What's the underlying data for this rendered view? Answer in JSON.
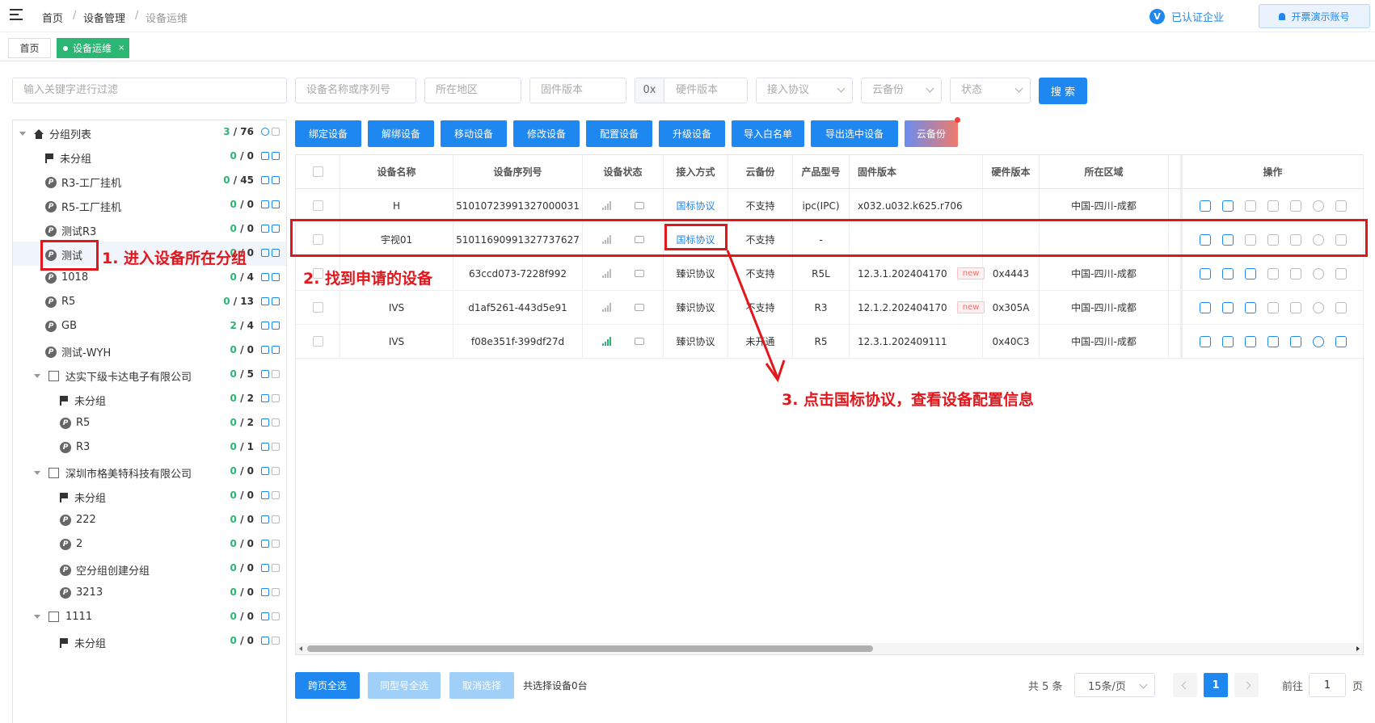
{
  "header": {
    "breadcrumb": [
      "首页",
      "/",
      "设备管理",
      "/",
      "设备运维"
    ],
    "certified_label": "已认证企业",
    "certified_badge": "V",
    "account_label": "开票演示账号"
  },
  "tabs": {
    "home": "首页",
    "active": "设备运维",
    "close": "×"
  },
  "filters": {
    "keyword_placeholder": "输入关键字进行过滤",
    "name_placeholder": "设备名称或序列号",
    "region_placeholder": "所在地区",
    "firmware_placeholder": "固件版本",
    "hex_prefix": "0x",
    "hardware_placeholder": "硬件版本",
    "protocol_placeholder": "接入协议",
    "backup_placeholder": "云备份",
    "status_placeholder": "状态",
    "search_label": "搜 索"
  },
  "tree": [
    {
      "label": "分组列表",
      "online": "3",
      "total": " / 76"
    },
    {
      "label": "未分组",
      "online": "0",
      "total": " / 0"
    },
    {
      "label": "R3-工厂挂机",
      "online": "0",
      "total": " / 45"
    },
    {
      "label": "R5-工厂挂机",
      "online": "0",
      "total": " / 0"
    },
    {
      "label": "测试R3",
      "online": "0",
      "total": " / 0"
    },
    {
      "label": "测试",
      "online": "0",
      "total": " / 0"
    },
    {
      "label": "1018",
      "online": "0",
      "total": " / 4"
    },
    {
      "label": "R5",
      "online": "0",
      "total": " / 13"
    },
    {
      "label": "GB",
      "online": "2",
      "total": " / 4"
    },
    {
      "label": "测试-WYH",
      "online": "0",
      "total": " / 0"
    },
    {
      "label": "达实下级卡达电子有限公司",
      "online": "0",
      "total": " / 5"
    },
    {
      "label": "未分组",
      "online": "0",
      "total": " / 2"
    },
    {
      "label": "R5",
      "online": "0",
      "total": " / 2"
    },
    {
      "label": "R3",
      "online": "0",
      "total": " / 1"
    },
    {
      "label": "深圳市格美特科技有限公司",
      "online": "0",
      "total": " / 0"
    },
    {
      "label": "未分组",
      "online": "0",
      "total": " / 0"
    },
    {
      "label": "222",
      "online": "0",
      "total": " / 0"
    },
    {
      "label": "2",
      "online": "0",
      "total": " / 0"
    },
    {
      "label": "空分组创建分组",
      "online": "0",
      "total": " / 0"
    },
    {
      "label": "3213",
      "online": "0",
      "total": " / 0"
    },
    {
      "label": "1111",
      "online": "0",
      "total": " / 0"
    },
    {
      "label": "未分组",
      "online": "0",
      "total": " / 0"
    }
  ],
  "actions": [
    "绑定设备",
    "解绑设备",
    "移动设备",
    "修改设备",
    "配置设备",
    "升级设备",
    "导入白名单",
    "导出选中设备",
    "云备份"
  ],
  "table": {
    "columns": [
      "设备名称",
      "设备序列号",
      "设备状态",
      "接入方式",
      "云备份",
      "产品型号",
      "固件版本",
      "硬件版本",
      "所在区域",
      "操作"
    ],
    "rows": [
      {
        "name": "H",
        "serial": "51010723991327000031",
        "online": false,
        "access": "国标协议",
        "backup": "不支持",
        "model": "ipc(IPC)",
        "firmware": "x032.u032.k625.r706",
        "is_new": false,
        "hardware": "",
        "region": "中国-四川-成都"
      },
      {
        "name": "宇视01",
        "serial": "51011690991327737627",
        "online": false,
        "access": "国标协议",
        "backup": "不支持",
        "model": "-",
        "firmware": "",
        "is_new": false,
        "hardware": "",
        "region": ""
      },
      {
        "name": "",
        "serial": "63ccd073-7228f992",
        "online": false,
        "access": "臻识协议",
        "backup": "不支持",
        "model": "R5L",
        "firmware": "12.3.1.202404170",
        "is_new": true,
        "hardware": "0x4443",
        "region": "中国-四川-成都"
      },
      {
        "name": "IVS",
        "serial": "d1af5261-443d5e91",
        "online": false,
        "access": "臻识协议",
        "backup": "不支持",
        "model": "R3",
        "firmware": "12.1.2.202404170",
        "is_new": true,
        "hardware": "0x305A",
        "region": "中国-四川-成都"
      },
      {
        "name": "IVS",
        "serial": "f08e351f-399df27d",
        "online": true,
        "access": "臻识协议",
        "backup": "未开通",
        "model": "R5",
        "firmware": "12.3.1.202409111",
        "is_new": false,
        "hardware": "0x40C3",
        "region": "中国-四川-成都"
      }
    ],
    "new_label": "new"
  },
  "footer": {
    "select_all_pages": "跨页全选",
    "select_same_model": "同型号全选",
    "cancel_selection": "取消选择",
    "selected_count": "共选择设备0台",
    "total": "共 5 条",
    "page_size": "15条/页",
    "current_page": "1",
    "goto_label": "前往",
    "goto_value": "1",
    "page_unit": "页"
  },
  "annotations": {
    "step1": "1. 进入设备所在分组",
    "step2": "2. 找到申请的设备",
    "step3": "3. 点击国标协议，查看设备配置信息"
  },
  "colors": {
    "primary": "#1e87f0",
    "success": "#2bb673",
    "annotation": "#e3161b"
  }
}
